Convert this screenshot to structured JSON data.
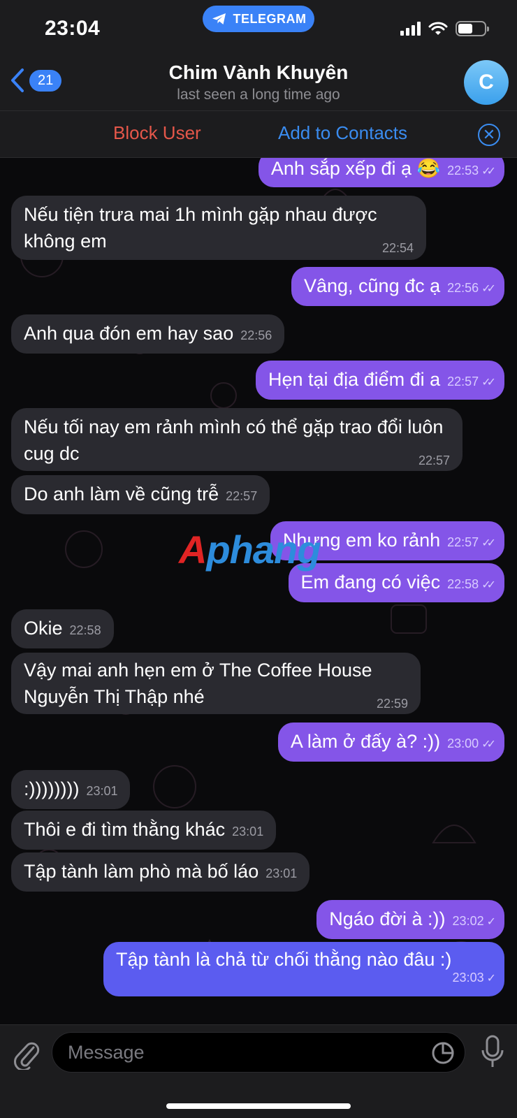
{
  "status_bar": {
    "time": "23:04",
    "app_pill": "TELEGRAM",
    "icons": [
      "signal-icon",
      "wifi-icon",
      "battery-icon"
    ]
  },
  "header": {
    "back_count": "21",
    "title": "Chim Vành Khuyên",
    "subtitle": "last seen a long time ago",
    "avatar_letter": "C"
  },
  "actions": {
    "block": "Block User",
    "add": "Add to Contacts"
  },
  "messages": [
    {
      "dir": "out",
      "text": "Anh sắp xếp đi ạ 😂",
      "time": "22:53",
      "status": "read"
    },
    {
      "dir": "in",
      "text": "Nếu tiện trưa mai 1h mình gặp nhau được không em",
      "time": "22:54"
    },
    {
      "dir": "out",
      "text": "Vâng, cũng đc ạ",
      "time": "22:56",
      "status": "read"
    },
    {
      "dir": "in",
      "text": "Anh qua đón em hay sao",
      "time": "22:56"
    },
    {
      "dir": "out",
      "text": "Hẹn tại địa điểm đi a",
      "time": "22:57",
      "status": "read"
    },
    {
      "dir": "in",
      "text": "Nếu tối nay em rảnh mình có thể gặp trao đổi luôn cug dc",
      "time": "22:57"
    },
    {
      "dir": "in",
      "text": "Do anh làm về cũng trễ",
      "time": "22:57"
    },
    {
      "dir": "out",
      "text": "Nhưng em ko rảnh",
      "time": "22:57",
      "status": "read"
    },
    {
      "dir": "out",
      "text": "Em đang có việc",
      "time": "22:58",
      "status": "read"
    },
    {
      "dir": "in",
      "text": "Okie",
      "time": "22:58"
    },
    {
      "dir": "in",
      "text": "Vậy mai anh hẹn em ở The Coffee House Nguyễn Thị Thập nhé",
      "time": "22:59"
    },
    {
      "dir": "out",
      "text": "A làm ở đấy à? :))",
      "time": "23:00",
      "status": "read"
    },
    {
      "dir": "in",
      "text": ":))))))))",
      "time": "23:01"
    },
    {
      "dir": "in",
      "text": "Thôi e đi tìm thằng khác",
      "time": "23:01"
    },
    {
      "dir": "in",
      "text": "Tập tành làm phò mà bố láo",
      "time": "23:01"
    },
    {
      "dir": "out",
      "text": "Ngáo đời à :))",
      "time": "23:02",
      "status": "sent"
    },
    {
      "dir": "out",
      "text": "Tập tành là chả từ chối thằng nào đâu :)",
      "time": "23:03",
      "status": "sent"
    }
  ],
  "watermark": {
    "first": "A",
    "rest": "phang"
  },
  "composer": {
    "placeholder": "Message"
  },
  "colors": {
    "accent": "#3a82f7",
    "outgoing_bubble": "#8455e8",
    "outgoing_last": "#5b5cf0",
    "incoming_bubble": "#2a2a30",
    "danger": "#e5574a"
  }
}
